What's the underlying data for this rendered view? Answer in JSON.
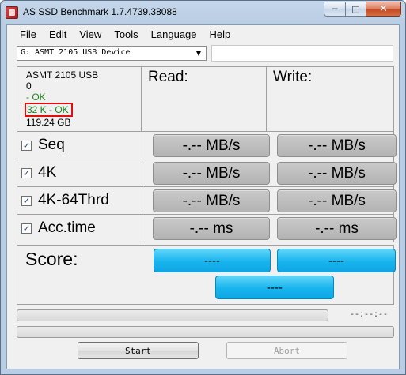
{
  "window": {
    "title": "AS SSD Benchmark 1.7.4739.38088",
    "controls": {
      "minimize": "─",
      "maximize": "□",
      "close": "✕"
    }
  },
  "menu": {
    "items": [
      "File",
      "Edit",
      "View",
      "Tools",
      "Language",
      "Help"
    ]
  },
  "drive": {
    "selected": "G: ASMT 2105 USB Device",
    "arrow": "▼"
  },
  "info": {
    "device_name": "ASMT 2105 USB",
    "line2": "0",
    "status_ok": "- OK",
    "alignment": "32 K - OK",
    "capacity": "119.24 GB"
  },
  "columns": {
    "read": "Read:",
    "write": "Write:"
  },
  "tests": [
    {
      "label": "Seq",
      "checked": "✓",
      "read": "-.-- MB/s",
      "write": "-.-- MB/s"
    },
    {
      "label": "4K",
      "checked": "✓",
      "read": "-.-- MB/s",
      "write": "-.-- MB/s"
    },
    {
      "label": "4K-64Thrd",
      "checked": "✓",
      "read": "-.-- MB/s",
      "write": "-.-- MB/s"
    },
    {
      "label": "Acc.time",
      "checked": "✓",
      "read": "-.-- ms",
      "write": "-.-- ms"
    }
  ],
  "score": {
    "label": "Score:",
    "read": "----",
    "write": "----",
    "total": "----"
  },
  "timer": "--:--:--",
  "buttons": {
    "start": "Start",
    "abort": "Abort"
  },
  "colors": {
    "ok_green": "#1a8a1a",
    "highlight_red": "#e01010",
    "score_blue": "#18b4ee"
  }
}
